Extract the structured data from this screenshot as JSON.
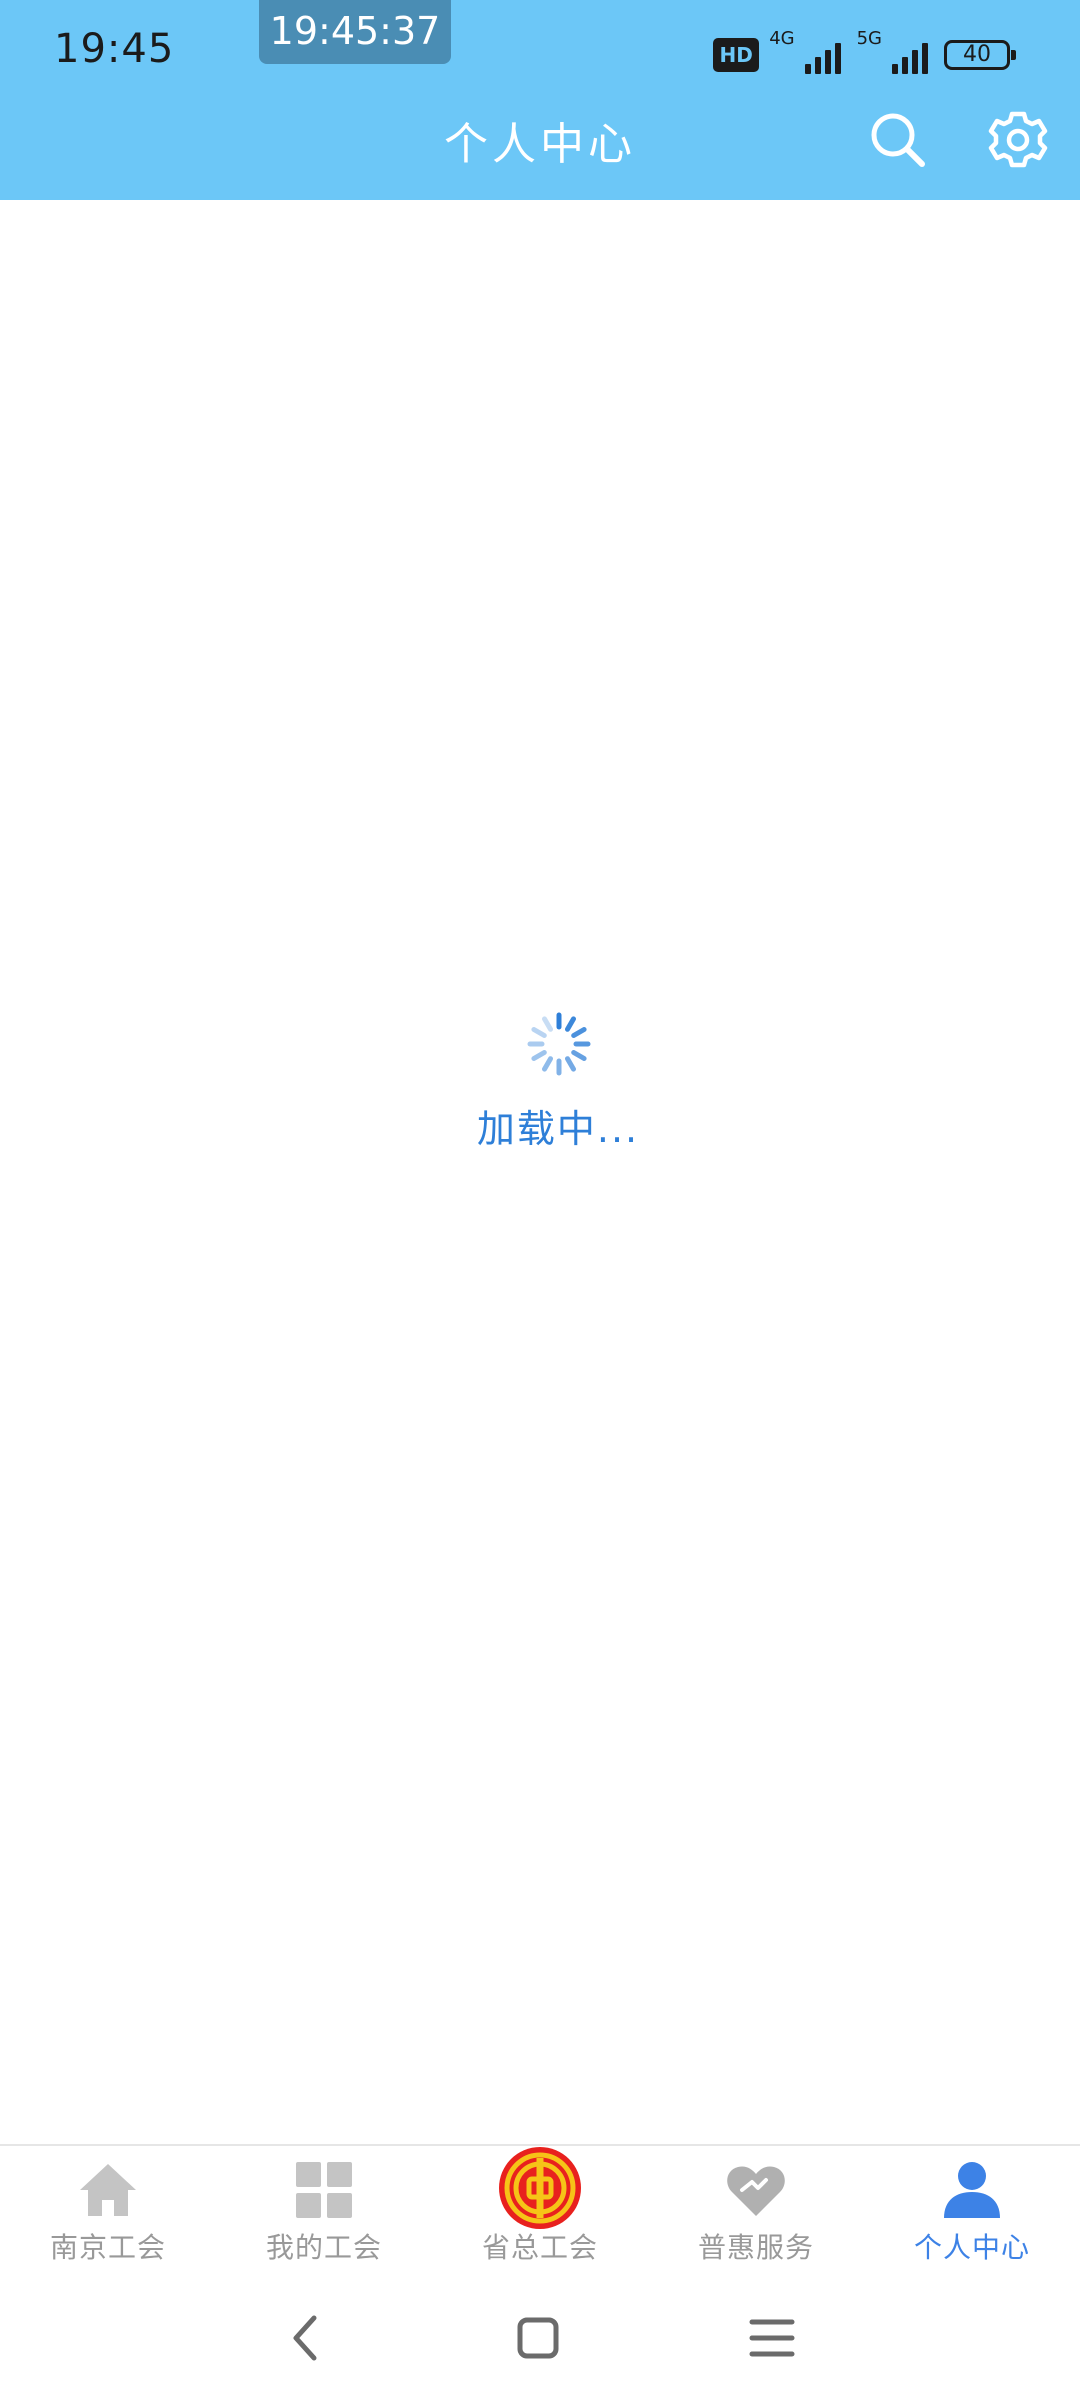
{
  "status_bar": {
    "time": "19:45",
    "clock_overlay": "19:45:37",
    "hd_badge": "HD",
    "network_1": "4G",
    "network_2": "5G",
    "battery": "40"
  },
  "header": {
    "title": "个人中心",
    "search_icon": "search-icon",
    "settings_icon": "gear-icon",
    "background_color": "#6cc7f7"
  },
  "loading": {
    "text": "加载中...",
    "icon": "spinner-icon",
    "color": "#2e7fd8"
  },
  "tabs": [
    {
      "label": "南京工会",
      "icon": "home-icon",
      "active": false
    },
    {
      "label": "我的工会",
      "icon": "grid-icon",
      "active": false
    },
    {
      "label": "省总工会",
      "icon": "union-emblem-icon",
      "active": false
    },
    {
      "label": "普惠服务",
      "icon": "heart-icon",
      "active": false
    },
    {
      "label": "个人中心",
      "icon": "person-icon",
      "active": true
    }
  ],
  "colors": {
    "tab_active": "#3d82e6",
    "tab_inactive": "#999999"
  }
}
